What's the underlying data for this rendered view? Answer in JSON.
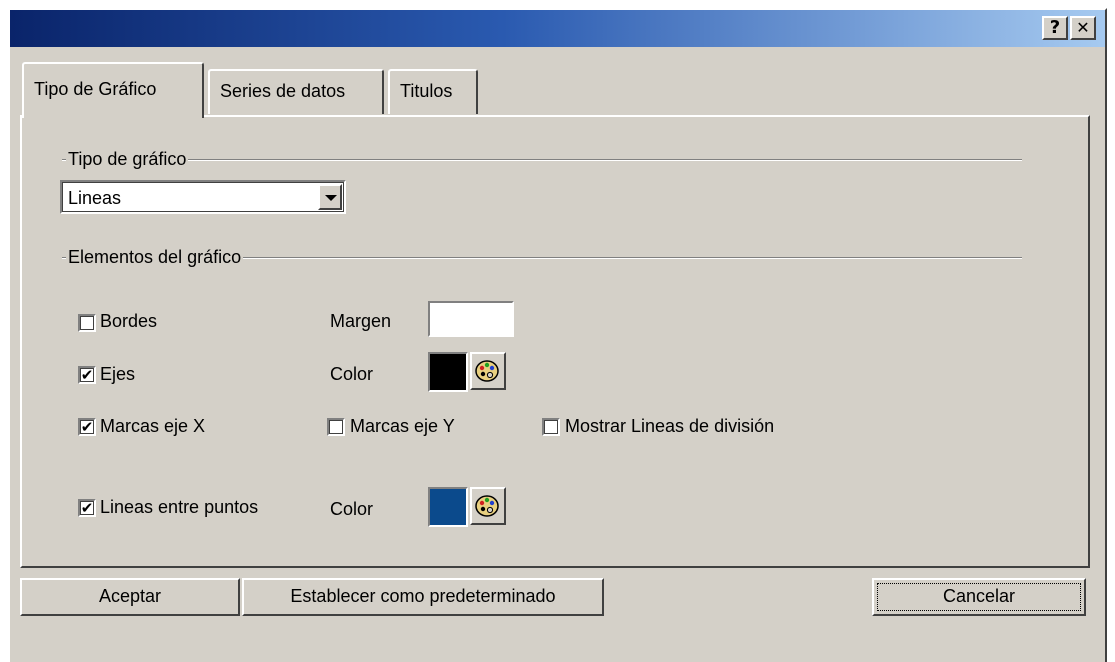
{
  "titlebar": {
    "help_label": "?",
    "close_label": "✕"
  },
  "tabs": [
    {
      "label": "Tipo de Gráfico",
      "active": true
    },
    {
      "label": "Series de datos",
      "active": false
    },
    {
      "label": "Titulos",
      "active": false
    }
  ],
  "chart_type_group": {
    "title": "Tipo de gráfico",
    "selected": "Lineas"
  },
  "elements_group": {
    "title": "Elementos del gráfico",
    "bordes": {
      "label": "Bordes",
      "checked": false
    },
    "margen": {
      "label": "Margen",
      "value": ""
    },
    "ejes": {
      "label": "Ejes",
      "checked": true
    },
    "ejes_color": {
      "label": "Color",
      "value": "#000000"
    },
    "marcas_x": {
      "label": "Marcas eje X",
      "checked": true
    },
    "marcas_y": {
      "label": "Marcas eje Y",
      "checked": false
    },
    "mostrar_lineas": {
      "label": "Mostrar Lineas de división",
      "checked": false
    },
    "lineas_puntos": {
      "label": "Lineas entre puntos",
      "checked": true
    },
    "lineas_color": {
      "label": "Color",
      "value": "#0b4a8c"
    }
  },
  "buttons": {
    "aceptar": "Aceptar",
    "predeterminado": "Establecer como predeterminado",
    "cancelar": "Cancelar"
  },
  "icons": {
    "palette": "palette-icon",
    "dropdown": "chevron-down-icon",
    "check": "✔"
  }
}
